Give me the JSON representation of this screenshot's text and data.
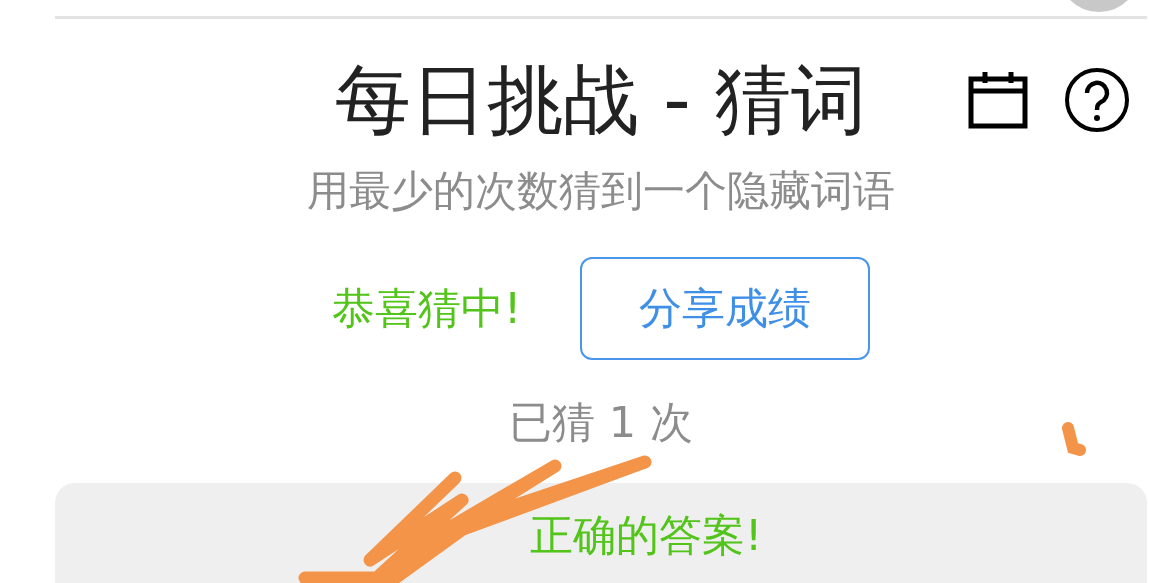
{
  "title": "每日挑战 - 猜词",
  "subtitle": "用最少的次数猜到一个隐藏词语",
  "status": {
    "text": "恭喜猜中!",
    "kind": "success"
  },
  "share_button": "分享成绩",
  "guess_count": "已猜 1 次",
  "result": {
    "text": "正确的答案!",
    "kind": "success"
  }
}
